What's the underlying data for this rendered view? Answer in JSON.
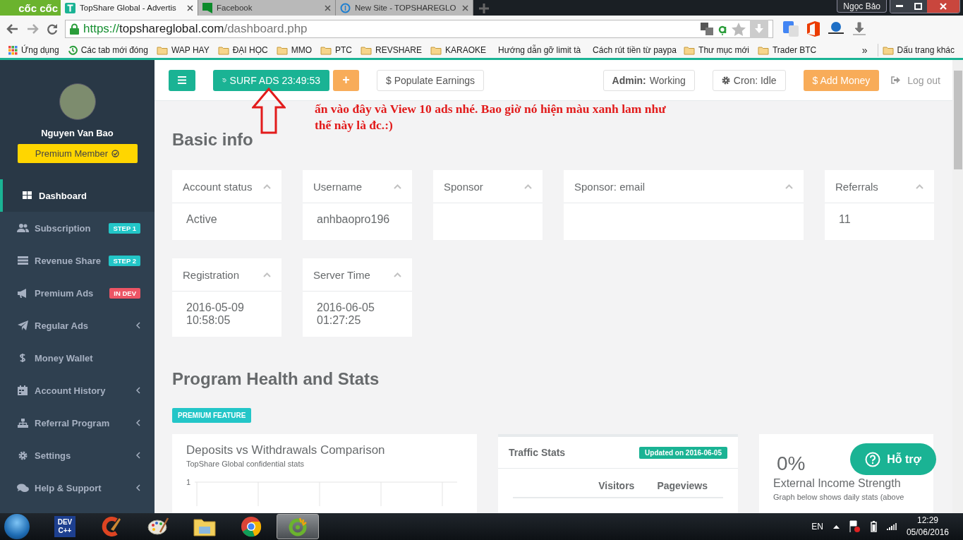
{
  "browser": {
    "logo": "cốc cốc",
    "tabs": [
      {
        "title": "TopShare Global - Advertis",
        "kind": "topshare",
        "selected": true
      },
      {
        "title": "Facebook",
        "kind": "facebook",
        "selected": false
      },
      {
        "title": "New Site - TOPSHAREGLO",
        "kind": "site",
        "selected": false
      }
    ],
    "profile": "Ngọc Bảo",
    "url": {
      "scheme": "https://",
      "host": "topshareglobal.com",
      "path": "/dashboard.php"
    },
    "bookmarks": [
      {
        "label": "Ứng dụng",
        "kind": "apps"
      },
      {
        "label": "Các tab mới đóng",
        "kind": "history"
      },
      {
        "label": "WAP HAY",
        "kind": "folder"
      },
      {
        "label": "ĐẠI HỌC",
        "kind": "folder"
      },
      {
        "label": "MMO",
        "kind": "folder"
      },
      {
        "label": "PTC",
        "kind": "folder"
      },
      {
        "label": "REVSHARE",
        "kind": "folder"
      },
      {
        "label": "KARAOKE",
        "kind": "folder"
      },
      {
        "label": "Hướng dẫn gỡ limit tà",
        "kind": "blogger"
      },
      {
        "label": "Cách rút tiền từ paypa",
        "kind": "page"
      },
      {
        "label": "Thư mục mới",
        "kind": "folder"
      },
      {
        "label": "Trader BTC",
        "kind": "folder"
      }
    ],
    "more_bookmarks": "»",
    "other_bookmarks": "Dấu trang khác"
  },
  "sidebar": {
    "user_name": "Nguyen Van Bao",
    "membership": "Premium Member",
    "items": [
      {
        "label": "Dashboard",
        "kind": "link",
        "selected": true
      },
      {
        "label": "Subscription",
        "kind": "link",
        "selected": false,
        "badge": {
          "text": "STEP 1",
          "color": "#23c6c8"
        }
      },
      {
        "label": "Revenue Share",
        "kind": "link",
        "selected": false,
        "badge": {
          "text": "STEP 2",
          "color": "#23c6c8"
        }
      },
      {
        "label": "Premium Ads",
        "kind": "link",
        "selected": false,
        "badge": {
          "text": "IN DEV",
          "color": "#ed5565"
        }
      },
      {
        "label": "Regular Ads",
        "kind": "submenu",
        "selected": false
      },
      {
        "label": "Money Wallet",
        "kind": "link",
        "selected": false
      },
      {
        "label": "Account History",
        "kind": "submenu",
        "selected": false
      },
      {
        "label": "Referral Program",
        "kind": "submenu",
        "selected": false
      },
      {
        "label": "Settings",
        "kind": "submenu",
        "selected": false
      },
      {
        "label": "Help & Support",
        "kind": "submenu",
        "selected": false
      }
    ]
  },
  "topbar": {
    "surf_ads": "SURF ADS 23:49:53",
    "add": "+",
    "populate": "$ Populate Earnings",
    "admin_status": "**Admin:** Working",
    "cron": "Cron: Idle",
    "add_money": "$ Add Money",
    "logout": "Log out"
  },
  "annotation": {
    "text": "ấn vào đây và View 10 ads nhé. Bao giờ nó hiện màu xanh lam như thế này là đc.:)"
  },
  "basic_info": {
    "title": "Basic info",
    "cards": [
      {
        "label": "Account status",
        "value": "Active"
      },
      {
        "label": "Username",
        "value": "anhbaopro196"
      },
      {
        "label": "Sponsor"
      },
      {
        "label": "Sponsor: email"
      },
      {
        "label": "Referrals",
        "value": "11"
      },
      {
        "label": "Registration",
        "value": "2016-05-09 10:58:05"
      },
      {
        "label": "Server Time",
        "value": "2016-06-05 01:27:25"
      }
    ]
  },
  "health": {
    "title": "Program Health and Stats",
    "badge": "PREMIUM FEATURE",
    "deposits": {
      "title": "Deposits vs Withdrawals Comparison",
      "subtitle": "TopShare Global confidential stats",
      "y_tick": "1"
    },
    "traffic": {
      "title": "Traffic Stats",
      "updated": "Updated on 2016-06-05",
      "columns": [
        "Visitors",
        "Pageviews"
      ]
    },
    "external": {
      "value": "0%",
      "title": "External Income Strength",
      "note": "Graph below shows daily stats (above"
    }
  },
  "help_button": "Hỗ trợ",
  "taskbar": {
    "apps": [
      {
        "kind": "devcpp",
        "label": "DEV C++",
        "selected": false
      },
      {
        "kind": "ccleaner",
        "selected": false
      },
      {
        "kind": "paint",
        "selected": false
      },
      {
        "kind": "explorer",
        "selected": false
      },
      {
        "kind": "chrome",
        "selected": false
      },
      {
        "kind": "coccoc",
        "selected": true
      }
    ],
    "language": "EN",
    "time": "12:29",
    "date": "05/06/2016"
  }
}
